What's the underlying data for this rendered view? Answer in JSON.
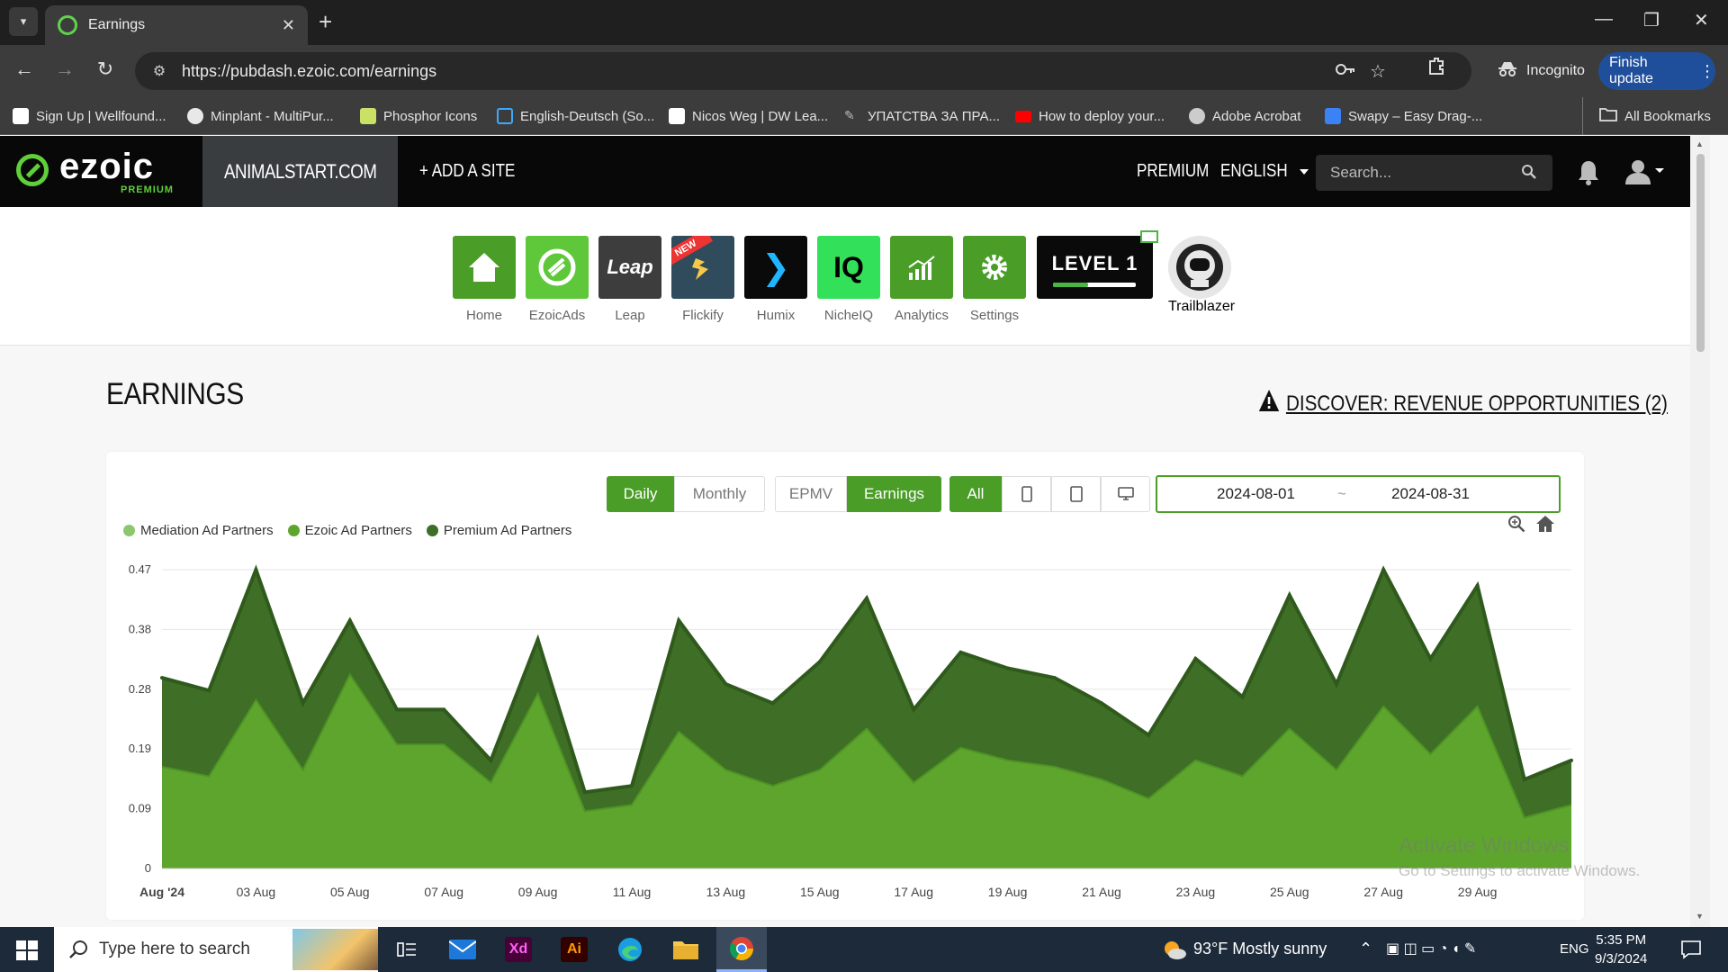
{
  "browser": {
    "tab_title": "Earnings",
    "url": "https://pubdash.ezoic.com/earnings",
    "incognito_label": "Incognito",
    "finish_update_label": "Finish update",
    "all_bookmarks_label": "All Bookmarks",
    "bookmarks": [
      {
        "label": "Sign Up | Wellfound...",
        "icon_color": "#ffffff"
      },
      {
        "label": "Minplant - MultiPur...",
        "icon_color": "#e8e8e8"
      },
      {
        "label": "Phosphor Icons",
        "icon_color": "#c9e265"
      },
      {
        "label": "English-Deutsch (So...",
        "icon_color": "#3da9fc"
      },
      {
        "label": "Nicos Weg | DW Lea...",
        "icon_color": "#ffffff"
      },
      {
        "label": "УПАТСТВА ЗА ПРА...",
        "icon_color": "#bbbbbb"
      },
      {
        "label": "How to deploy your...",
        "icon_color": "#ff0000"
      },
      {
        "label": "Adobe Acrobat",
        "icon_color": "#cccccc"
      },
      {
        "label": "Swapy – Easy Drag-...",
        "icon_color": "#3b82f6"
      }
    ]
  },
  "header": {
    "logo_text": "ezoic",
    "logo_sub": "PREMIUM",
    "site_name": "ANIMALSTART.COM",
    "add_site": "+ ADD A SITE",
    "premium": "PREMIUM",
    "language": "ENGLISH",
    "search_placeholder": "Search..."
  },
  "apps": [
    {
      "label": "Home",
      "icon": "home-icon",
      "color": "#4a9e28"
    },
    {
      "label": "EzoicAds",
      "icon": "ezoicads-icon",
      "color": "#5fc83a"
    },
    {
      "label": "Leap",
      "icon": "leap-icon",
      "color": "#3d3d3d"
    },
    {
      "label": "Flickify",
      "icon": "flickify-icon",
      "color": "#2f4b5c"
    },
    {
      "label": "Humix",
      "icon": "humix-icon",
      "color": "#0a0a0a"
    },
    {
      "label": "NicheIQ",
      "icon": "nicheiq-icon",
      "color": "#33e05a"
    },
    {
      "label": "Analytics",
      "icon": "analytics-icon",
      "color": "#4a9e28"
    },
    {
      "label": "Settings",
      "icon": "settings-icon",
      "color": "#4a9e28"
    }
  ],
  "leap_tile_text": "Leap",
  "flickify_badge": "NEW",
  "humix_glyph": "❯",
  "nicheiq_tile_text": "IQ",
  "level": {
    "text": "LEVEL 1",
    "progress": 0.42
  },
  "trailblazer_label": "Trailblazer",
  "page": {
    "title": "EARNINGS",
    "discover_link": "DISCOVER: REVENUE OPPORTUNITIES (2)"
  },
  "controls": {
    "period": [
      {
        "label": "Daily",
        "active": true
      },
      {
        "label": "Monthly",
        "active": false
      }
    ],
    "metric": [
      {
        "label": "EPMV",
        "active": false
      },
      {
        "label": "Earnings",
        "active": true
      }
    ],
    "device": [
      {
        "label": "All",
        "active": true
      },
      {
        "icon": "phone-icon"
      },
      {
        "icon": "tablet-icon"
      },
      {
        "icon": "desktop-icon"
      }
    ],
    "date_start": "2024-08-01",
    "date_sep": "~",
    "date_end": "2024-08-31"
  },
  "chart_data": {
    "type": "area",
    "stacked": true,
    "x_tick_labels": [
      "Aug '24",
      "03 Aug",
      "05 Aug",
      "07 Aug",
      "09 Aug",
      "11 Aug",
      "13 Aug",
      "15 Aug",
      "17 Aug",
      "19 Aug",
      "21 Aug",
      "23 Aug",
      "25 Aug",
      "27 Aug",
      "29 Aug"
    ],
    "y_tick_labels": [
      "0",
      "0.09",
      "0.19",
      "0.28",
      "0.38",
      "0.47"
    ],
    "ylim": [
      0,
      0.47
    ],
    "x": [
      "2024-08-01",
      "2024-08-02",
      "2024-08-03",
      "2024-08-04",
      "2024-08-05",
      "2024-08-06",
      "2024-08-07",
      "2024-08-08",
      "2024-08-09",
      "2024-08-10",
      "2024-08-11",
      "2024-08-12",
      "2024-08-13",
      "2024-08-14",
      "2024-08-15",
      "2024-08-16",
      "2024-08-17",
      "2024-08-18",
      "2024-08-19",
      "2024-08-20",
      "2024-08-21",
      "2024-08-22",
      "2024-08-23",
      "2024-08-24",
      "2024-08-25",
      "2024-08-26",
      "2024-08-27",
      "2024-08-28",
      "2024-08-29",
      "2024-08-30",
      "2024-08-31"
    ],
    "series": [
      {
        "name": "Mediation Ad Partners",
        "color": "#8cc66e",
        "values": [
          0,
          0,
          0,
          0,
          0,
          0,
          0,
          0,
          0,
          0,
          0,
          0,
          0,
          0,
          0,
          0,
          0,
          0,
          0,
          0,
          0,
          0,
          0,
          0,
          0,
          0,
          0,
          0,
          0,
          0,
          0
        ]
      },
      {
        "name": "Ezoic Ad Partners",
        "color": "#5ea52e",
        "values": [
          0.16,
          0.145,
          0.265,
          0.155,
          0.305,
          0.195,
          0.195,
          0.135,
          0.275,
          0.09,
          0.1,
          0.215,
          0.155,
          0.13,
          0.155,
          0.22,
          0.135,
          0.19,
          0.17,
          0.16,
          0.14,
          0.11,
          0.17,
          0.145,
          0.22,
          0.155,
          0.255,
          0.18,
          0.255,
          0.08,
          0.1
        ]
      },
      {
        "name": "Premium Ad Partners",
        "color": "#3f6e27",
        "values": [
          0.14,
          0.135,
          0.205,
          0.105,
          0.085,
          0.055,
          0.055,
          0.035,
          0.085,
          0.03,
          0.03,
          0.175,
          0.135,
          0.13,
          0.17,
          0.205,
          0.115,
          0.15,
          0.145,
          0.14,
          0.12,
          0.1,
          0.16,
          0.125,
          0.21,
          0.135,
          0.215,
          0.15,
          0.19,
          0.06,
          0.07
        ]
      }
    ]
  },
  "watermark": {
    "line1": "Activate Windows",
    "line2": "Go to Settings to activate Windows."
  },
  "taskbar": {
    "search_placeholder": "Type here to search",
    "weather": "93°F  Mostly sunny",
    "lang": "ENG",
    "time": "5:35 PM",
    "date": "9/3/2024"
  }
}
